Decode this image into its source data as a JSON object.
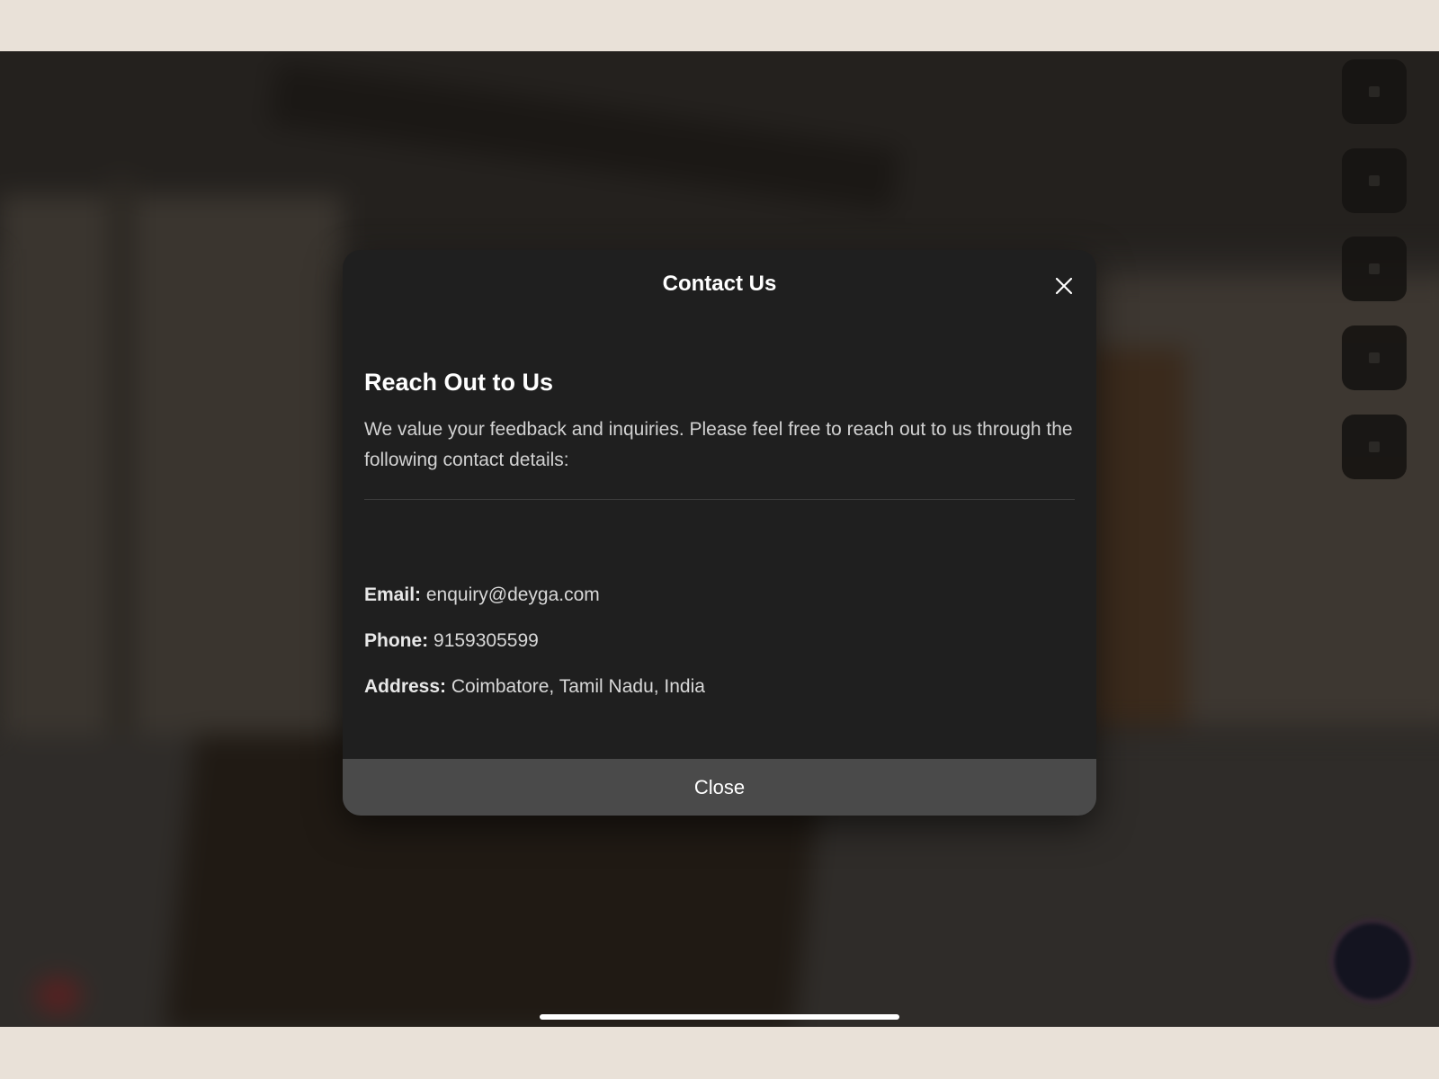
{
  "dialog": {
    "title": "Contact Us",
    "heading": "Reach Out to Us",
    "description": "We value your feedback and inquiries. Please feel free to reach out to us through the following contact details:",
    "contacts": [
      {
        "label": "Email:",
        "value": "enquiry@deyga.com"
      },
      {
        "label": "Phone:",
        "value": "9159305599"
      },
      {
        "label": "Address:",
        "value": "Coimbatore, Tamil Nadu, India"
      }
    ],
    "close_button_label": "Close",
    "close_icon": "close-icon"
  },
  "colors": {
    "dialog_bg": "#1f1f1f",
    "close_button_bg": "#4a4a4a",
    "page_bg": "#e9e1d8",
    "text_primary": "#ffffff"
  }
}
